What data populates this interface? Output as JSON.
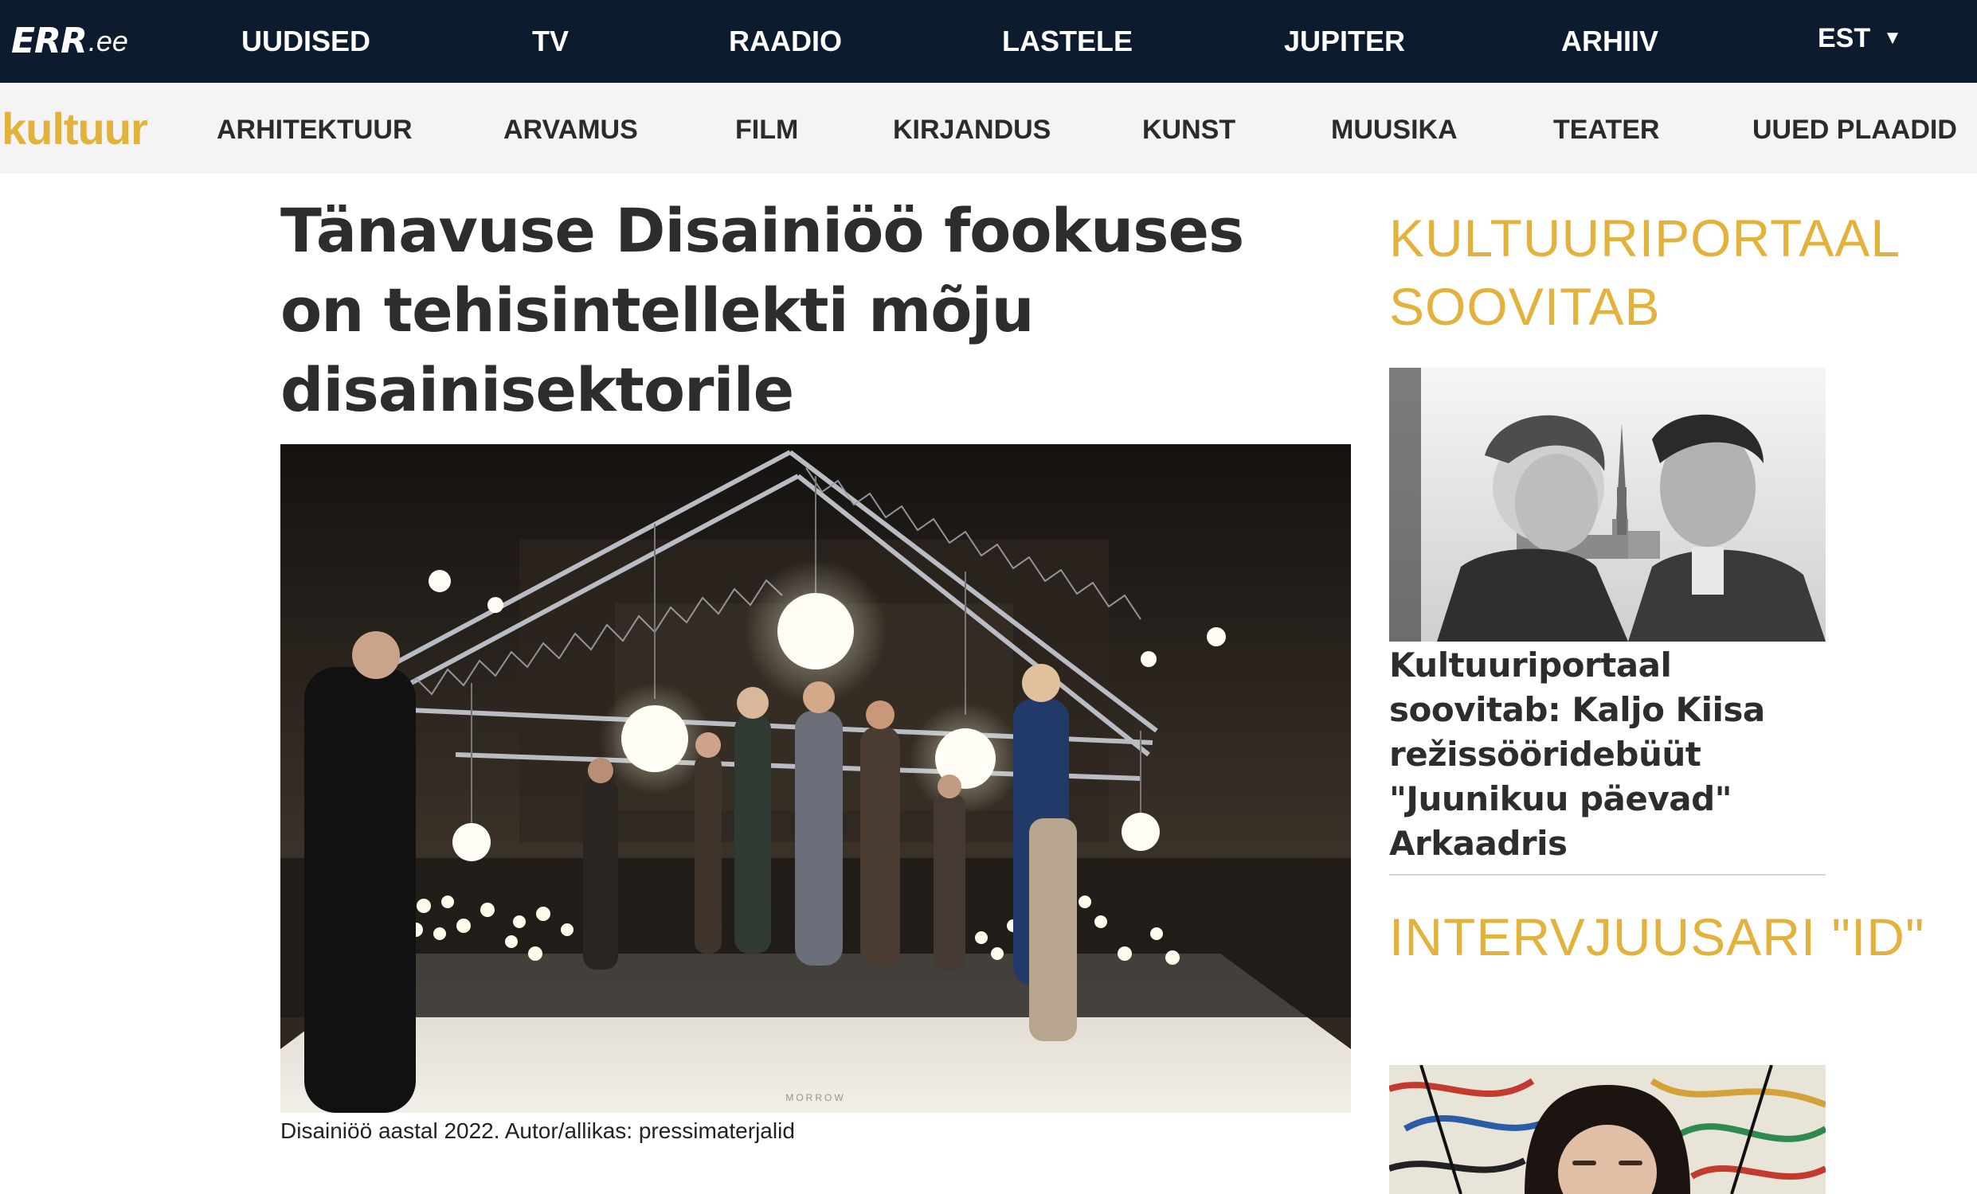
{
  "header": {
    "logo_mark": "ERR",
    "logo_tld": ".ee",
    "nav": [
      "UUDISED",
      "TV",
      "RAADIO",
      "LASTELE",
      "JUPITER",
      "ARHIIV"
    ],
    "language": "EST"
  },
  "section": {
    "name": "kultuur",
    "nav": [
      "ARHITEKTUUR",
      "ARVAMUS",
      "FILM",
      "KIRJANDUS",
      "KUNST",
      "MUUSIKA",
      "TEATER",
      "UUED PLAADID"
    ]
  },
  "article": {
    "headline": "Tänavuse Disainiöö fookuses on tehisintellekti mõju disainisektorile",
    "image_watermark": "MORROW",
    "caption": "Disainiöö aastal 2022. Autor/allikas: pressimaterjalid"
  },
  "sidebar": {
    "block1_heading": "KULTUURIPORTAAL SOOVITAB",
    "block1_title": "Kultuuriportaal soovitab: Kaljo Kiisa režissööridebüüt \"Juunikuu päevad\" Arkaadris",
    "block2_heading": "INTERVJUUSARI \"ID\""
  },
  "colors": {
    "header_bg": "#0d1b2e",
    "accent": "#e3b23c",
    "subnav_bg": "#f4f4f4"
  }
}
